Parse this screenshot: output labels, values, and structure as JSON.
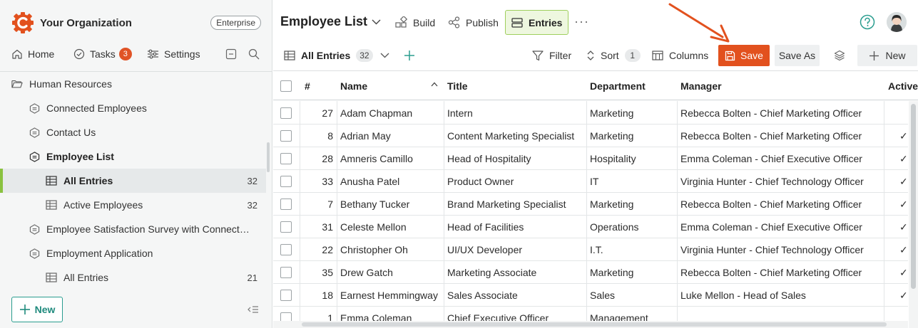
{
  "sidebar": {
    "org_name": "Your Organization",
    "plan_badge": "Enterprise",
    "nav": {
      "home": "Home",
      "tasks": "Tasks",
      "tasks_count": "3",
      "settings": "Settings"
    },
    "tree": [
      {
        "label": "Human Resources",
        "icon": "folder-open-icon",
        "level": 0,
        "count": "",
        "bold": false
      },
      {
        "label": "Connected Employees",
        "icon": "form-icon",
        "level": 1,
        "count": "",
        "bold": false
      },
      {
        "label": "Contact Us",
        "icon": "form-icon",
        "level": 1,
        "count": "",
        "bold": false
      },
      {
        "label": "Employee List",
        "icon": "form-icon",
        "level": 1,
        "count": "",
        "bold": true
      },
      {
        "label": "All Entries",
        "icon": "table-icon",
        "level": 2,
        "count": "32",
        "bold": true,
        "active": true
      },
      {
        "label": "Active Employees",
        "icon": "table-icon",
        "level": 2,
        "count": "32",
        "bold": false
      },
      {
        "label": "Employee Satisfaction Survey with Connecte...",
        "icon": "form-icon",
        "level": 1,
        "count": "",
        "bold": false
      },
      {
        "label": "Employment Application",
        "icon": "form-icon",
        "level": 1,
        "count": "",
        "bold": false
      },
      {
        "label": "All Entries",
        "icon": "table-icon",
        "level": 2,
        "count": "21",
        "bold": false
      }
    ],
    "new_button": "New"
  },
  "header": {
    "title": "Employee List",
    "build": "Build",
    "publish": "Publish",
    "entries": "Entries",
    "more": "···"
  },
  "toolbar": {
    "view_name": "All Entries",
    "view_count": "32",
    "filter": "Filter",
    "sort": "Sort",
    "sort_count": "1",
    "columns": "Columns",
    "save": "Save",
    "save_as": "Save As",
    "new": "New"
  },
  "grid": {
    "columns": [
      "#",
      "Name",
      "Title",
      "Department",
      "Manager",
      "Active"
    ],
    "rows": [
      {
        "num": "27",
        "name": "Adam Chapman",
        "title": "Intern",
        "dept": "Marketing",
        "manager": "Rebecca Bolten - Chief Marketing Officer",
        "active": ""
      },
      {
        "num": "8",
        "name": "Adrian May",
        "title": "Content Marketing Specialist",
        "dept": "Marketing",
        "manager": "Rebecca Bolten - Chief Marketing Officer",
        "active": "✓"
      },
      {
        "num": "28",
        "name": "Amneris Camillo",
        "title": "Head of Hospitality",
        "dept": "Hospitality",
        "manager": "Emma Coleman - Chief Executive Officer",
        "active": "✓"
      },
      {
        "num": "33",
        "name": "Anusha Patel",
        "title": "Product Owner",
        "dept": "IT",
        "manager": "Virginia Hunter - Chief Technology Officer",
        "active": "✓"
      },
      {
        "num": "7",
        "name": "Bethany Tucker",
        "title": "Brand Marketing Specialist",
        "dept": "Marketing",
        "manager": "Rebecca Bolten - Chief Marketing Officer",
        "active": "✓"
      },
      {
        "num": "31",
        "name": "Celeste Mellon",
        "title": "Head of Facilities",
        "dept": "Operations",
        "manager": "Emma Coleman - Chief Executive Officer",
        "active": "✓"
      },
      {
        "num": "22",
        "name": "Christopher Oh",
        "title": "UI/UX Developer",
        "dept": "I.T.",
        "manager": "Virginia Hunter - Chief Technology Officer",
        "active": "✓"
      },
      {
        "num": "35",
        "name": "Drew Gatch",
        "title": "Marketing Associate",
        "dept": "Marketing",
        "manager": "Rebecca Bolten - Chief Marketing Officer",
        "active": "✓"
      },
      {
        "num": "18",
        "name": "Earnest Hemmingway",
        "title": "Sales Associate",
        "dept": "Sales",
        "manager": "Luke Mellon - Head of Sales",
        "active": "✓"
      },
      {
        "num": "1",
        "name": "Emma Coleman",
        "title": "Chief Executive Officer",
        "dept": "Management",
        "manager": "",
        "active": ""
      }
    ]
  },
  "colors": {
    "accent_orange": "#e2511e",
    "accent_green": "#8ac240",
    "teal": "#2a9d8f"
  }
}
